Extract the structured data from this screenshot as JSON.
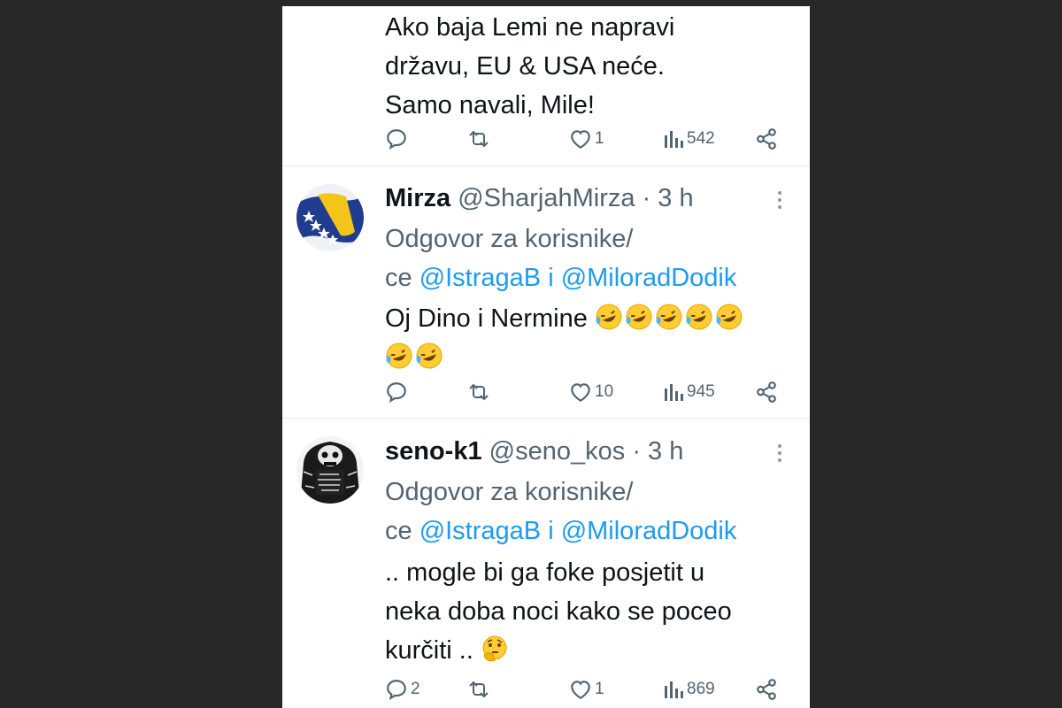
{
  "tweets": [
    {
      "lines": [
        "Ako baja Lemi ne napravi",
        "državu, EU & USA neće.",
        "Samo navali, Mile!"
      ],
      "actions": {
        "reply": "",
        "retweet": "",
        "like": "1",
        "views": "542"
      }
    },
    {
      "name": "Mirza",
      "handle": "@SharjahMirza",
      "sep": " · ",
      "time": "3 h",
      "replying_prefix_1": "Odgovor za korisnike/",
      "replying_prefix_2": "ce ",
      "mention_1": "@IstragaB",
      "conj": " i ",
      "mention_2": "@MiloradDodik",
      "line1": "Oj Dino i Nermine ",
      "actions": {
        "reply": "",
        "retweet": "",
        "like": "10",
        "views": "945"
      },
      "avatar_icon": "bosnia-flag-avatar"
    },
    {
      "name": "seno-k1",
      "handle": "@seno_kos",
      "sep": " · ",
      "time": "3 h",
      "replying_prefix_1": "Odgovor za korisnike/",
      "replying_prefix_2": "ce ",
      "mention_1": "@IstragaB",
      "conj": " i ",
      "mention_2": "@MiloradDodik",
      "lines": [
        ".. mogle bi ga foke posjetit u",
        "neka doba noci kako se poceo",
        "kurčiti .. "
      ],
      "actions": {
        "reply": "2",
        "retweet": "",
        "like": "1",
        "views": "869"
      },
      "avatar_icon": "skull-sketch-avatar"
    }
  ],
  "colors": {
    "text": "#0f1419",
    "secondary": "#536471",
    "link": "#1d9bf0",
    "background": "#272727"
  }
}
